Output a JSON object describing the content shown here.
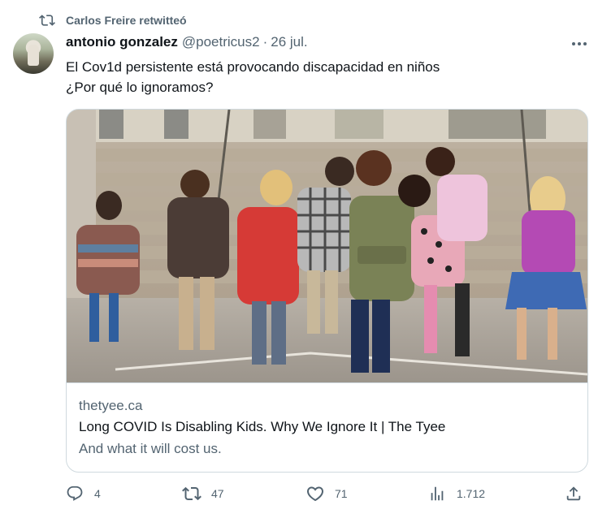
{
  "retweet_banner": {
    "icon": "retweet-icon",
    "text": "Carlos Freire retwitteó"
  },
  "author": {
    "name": "antonio gonzalez",
    "handle": "@poetricus2",
    "separator": "·",
    "date": "26 jul."
  },
  "tweet": {
    "lines": [
      "El Cov1d persistente está provocando discapacidad en niños",
      "¿Por qué lo ignoramos?"
    ]
  },
  "link_card": {
    "image_icon": "photo-children-with-backpacks",
    "domain": "thetyee.ca",
    "title": "Long COVID Is Disabling Kids. Why We Ignore It | The Tyee",
    "description": "And what it will cost us."
  },
  "actions": {
    "reply": {
      "icon": "reply-icon",
      "count": "4"
    },
    "retweet": {
      "icon": "retweet-icon",
      "count": "47"
    },
    "like": {
      "icon": "heart-icon",
      "count": "71"
    },
    "views": {
      "icon": "views-icon",
      "count": "1.712"
    },
    "share": {
      "icon": "share-icon"
    }
  },
  "colors": {
    "primary_text": "#0f1419",
    "secondary_text": "#536471",
    "border": "#cfd9de",
    "background": "#ffffff"
  }
}
